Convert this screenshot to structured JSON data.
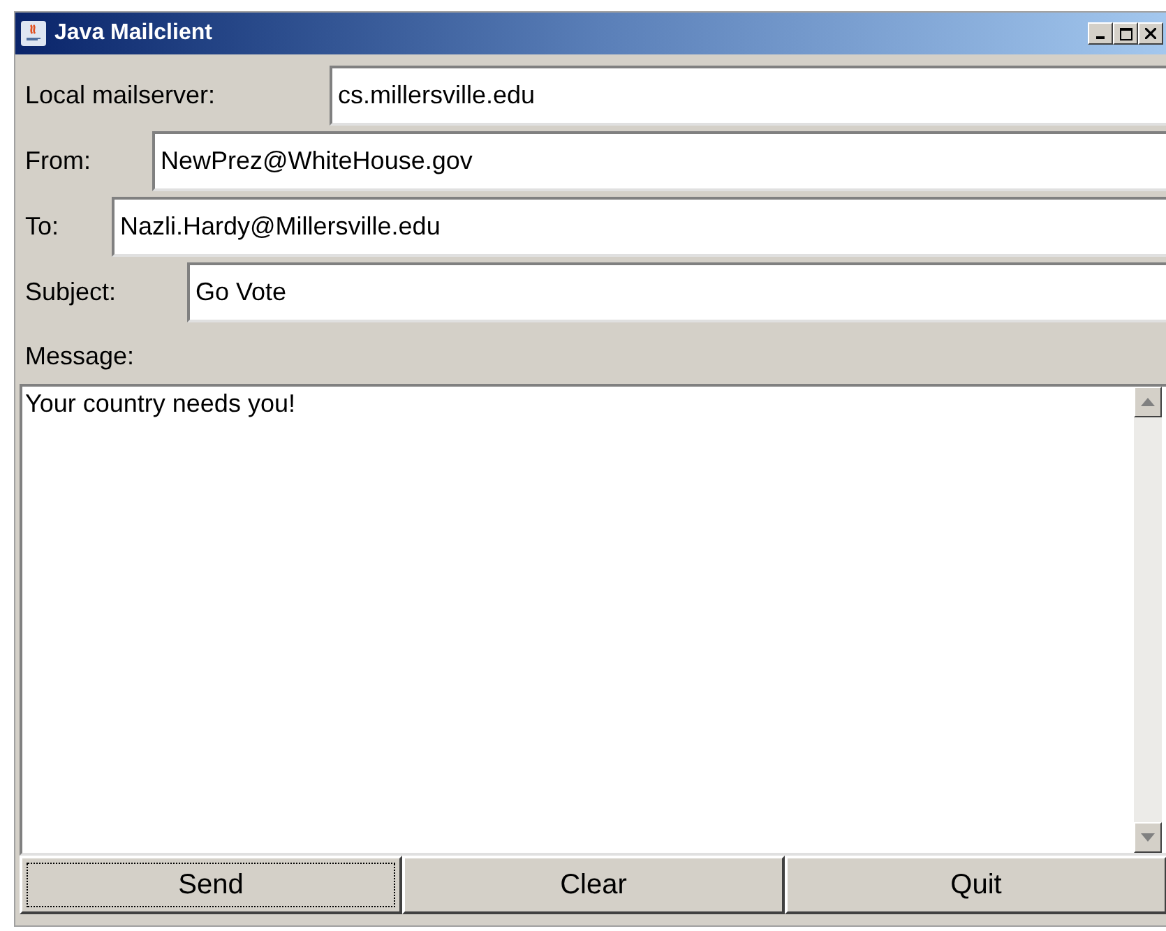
{
  "window": {
    "title": "Java Mailclient"
  },
  "fields": [
    {
      "label": "Local mailserver:",
      "value": "cs.millersville.edu"
    },
    {
      "label": "From:",
      "value": "NewPrez@WhiteHouse.gov"
    },
    {
      "label": "To:",
      "value": "Nazli.Hardy@Millersville.edu"
    },
    {
      "label": "Subject:",
      "value": "Go Vote"
    }
  ],
  "message": {
    "label": "Message:",
    "value": "Your country needs you!"
  },
  "buttons": [
    {
      "label": "Send",
      "focused": true
    },
    {
      "label": "Clear",
      "focused": false
    },
    {
      "label": "Quit",
      "focused": false
    }
  ]
}
